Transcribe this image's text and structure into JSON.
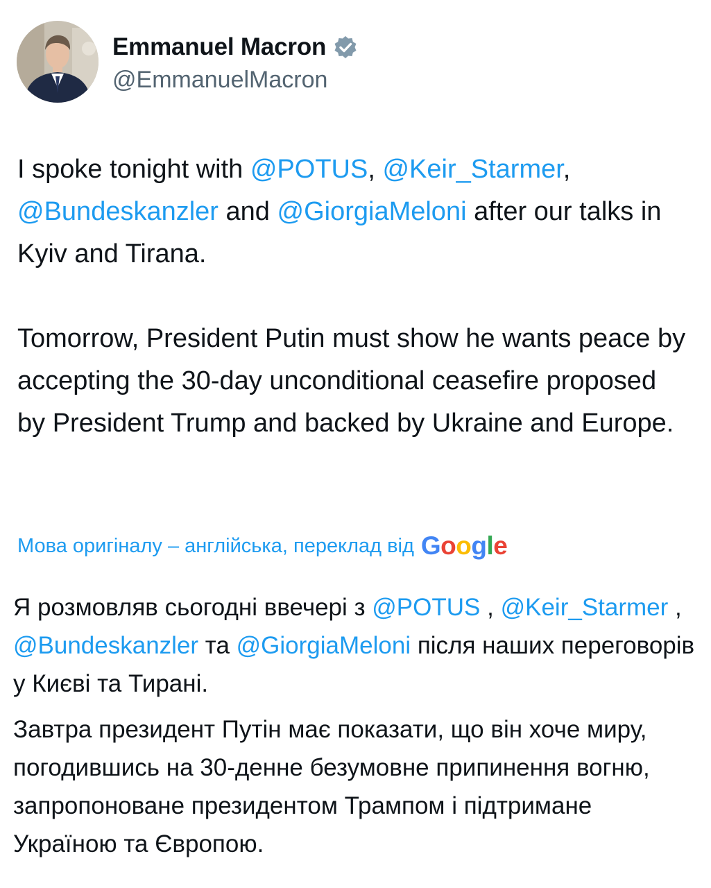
{
  "author": {
    "display_name": "Emmanuel Macron",
    "handle": "@EmmanuelMacron",
    "verified_icon": "verified-badge-icon",
    "avatar_icon": "profile-photo"
  },
  "tweet": {
    "p1_t1": "I spoke tonight with ",
    "p1_m1": "@POTUS",
    "p1_t2": ", ",
    "p1_m2": "@Keir_Starmer",
    "p1_t3": ", ",
    "p1_m3": "@Bundeskanzler",
    "p1_t4": " and ",
    "p1_m4": "@GiorgiaMeloni",
    "p1_t5": " after our talks in Kyiv and Tirana.",
    "p2": "Tomorrow, President Putin must show he wants peace by accepting the 30-day unconditional ceasefire proposed by President Trump and backed by Ukraine and Europe."
  },
  "translation": {
    "label": "Мова оригіналу – англійська, переклад від",
    "provider_letters": [
      "G",
      "o",
      "o",
      "g",
      "l",
      "e"
    ],
    "provider_colors": [
      "#4285F4",
      "#EA4335",
      "#FBBC05",
      "#4285F4",
      "#34A853",
      "#EA4335"
    ],
    "p1_t1": "Я розмовляв сьогодні ввечері з ",
    "p1_m1": "@POTUS",
    "p1_t2": " , ",
    "p1_m2": "@Keir_Starmer",
    "p1_t3": " , ",
    "p1_m3": "@Bundeskanzler",
    "p1_t4": " та ",
    "p1_m4": "@GiorgiaMeloni",
    "p1_t5": " після наших переговорів у Києві та Тирані.",
    "p2": "Завтра президент Путін має показати, що він хоче миру, погодившись на 30-денне безумовне припинення вогню, запропоноване президентом Трампом і підтримане Україною та Європою."
  },
  "colors": {
    "link": "#1d9bf0",
    "text": "#0f1419",
    "secondary": "#536471"
  }
}
